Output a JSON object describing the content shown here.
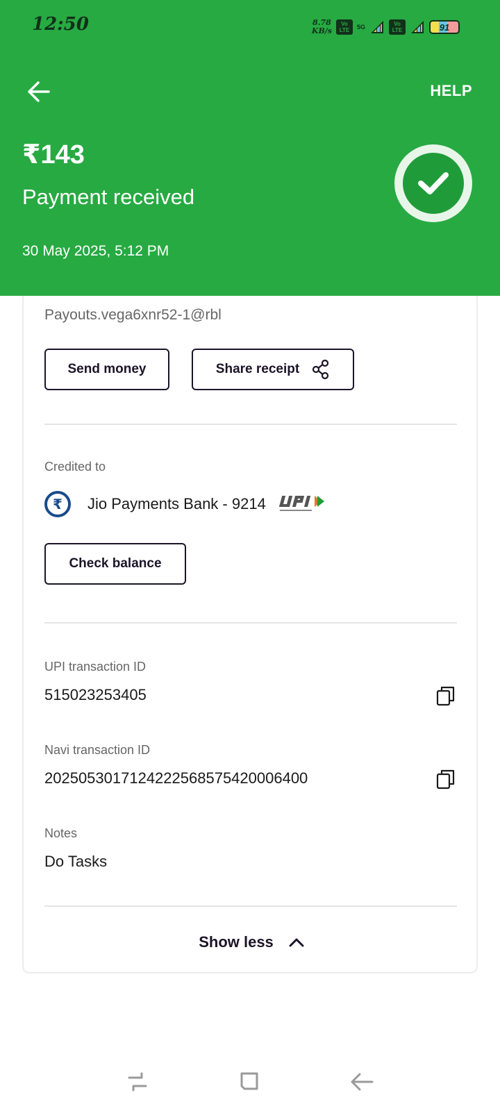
{
  "status_bar": {
    "time": "12:50",
    "speed_value": "8.78",
    "speed_unit": "KB/s",
    "volte_label": "Vo LTE",
    "network": "5G",
    "battery": "91"
  },
  "header": {
    "help_label": "HELP",
    "amount": "₹143",
    "status": "Payment received",
    "datetime": "30 May 2025, 5:12 PM",
    "icons": {
      "back": "arrow-left-icon",
      "success": "check-circle-icon"
    }
  },
  "details": {
    "sender_upi": "Payouts.vega6xnr52-1@rbl",
    "send_money_label": "Send money",
    "share_receipt_label": "Share receipt",
    "credited_to_label": "Credited to",
    "bank_name": "Jio Payments Bank - 9214",
    "check_balance_label": "Check balance",
    "upi_txn_label": "UPI transaction ID",
    "upi_txn_id": "515023253405",
    "navi_txn_label": "Navi transaction ID",
    "navi_txn_id": "2025053017124222568575420006400",
    "notes_label": "Notes",
    "notes_value": "Do Tasks",
    "show_less_label": "Show less"
  },
  "colors": {
    "header_bg": "#27aa42",
    "success": "#1f9c39",
    "button_border": "#1c1428"
  }
}
